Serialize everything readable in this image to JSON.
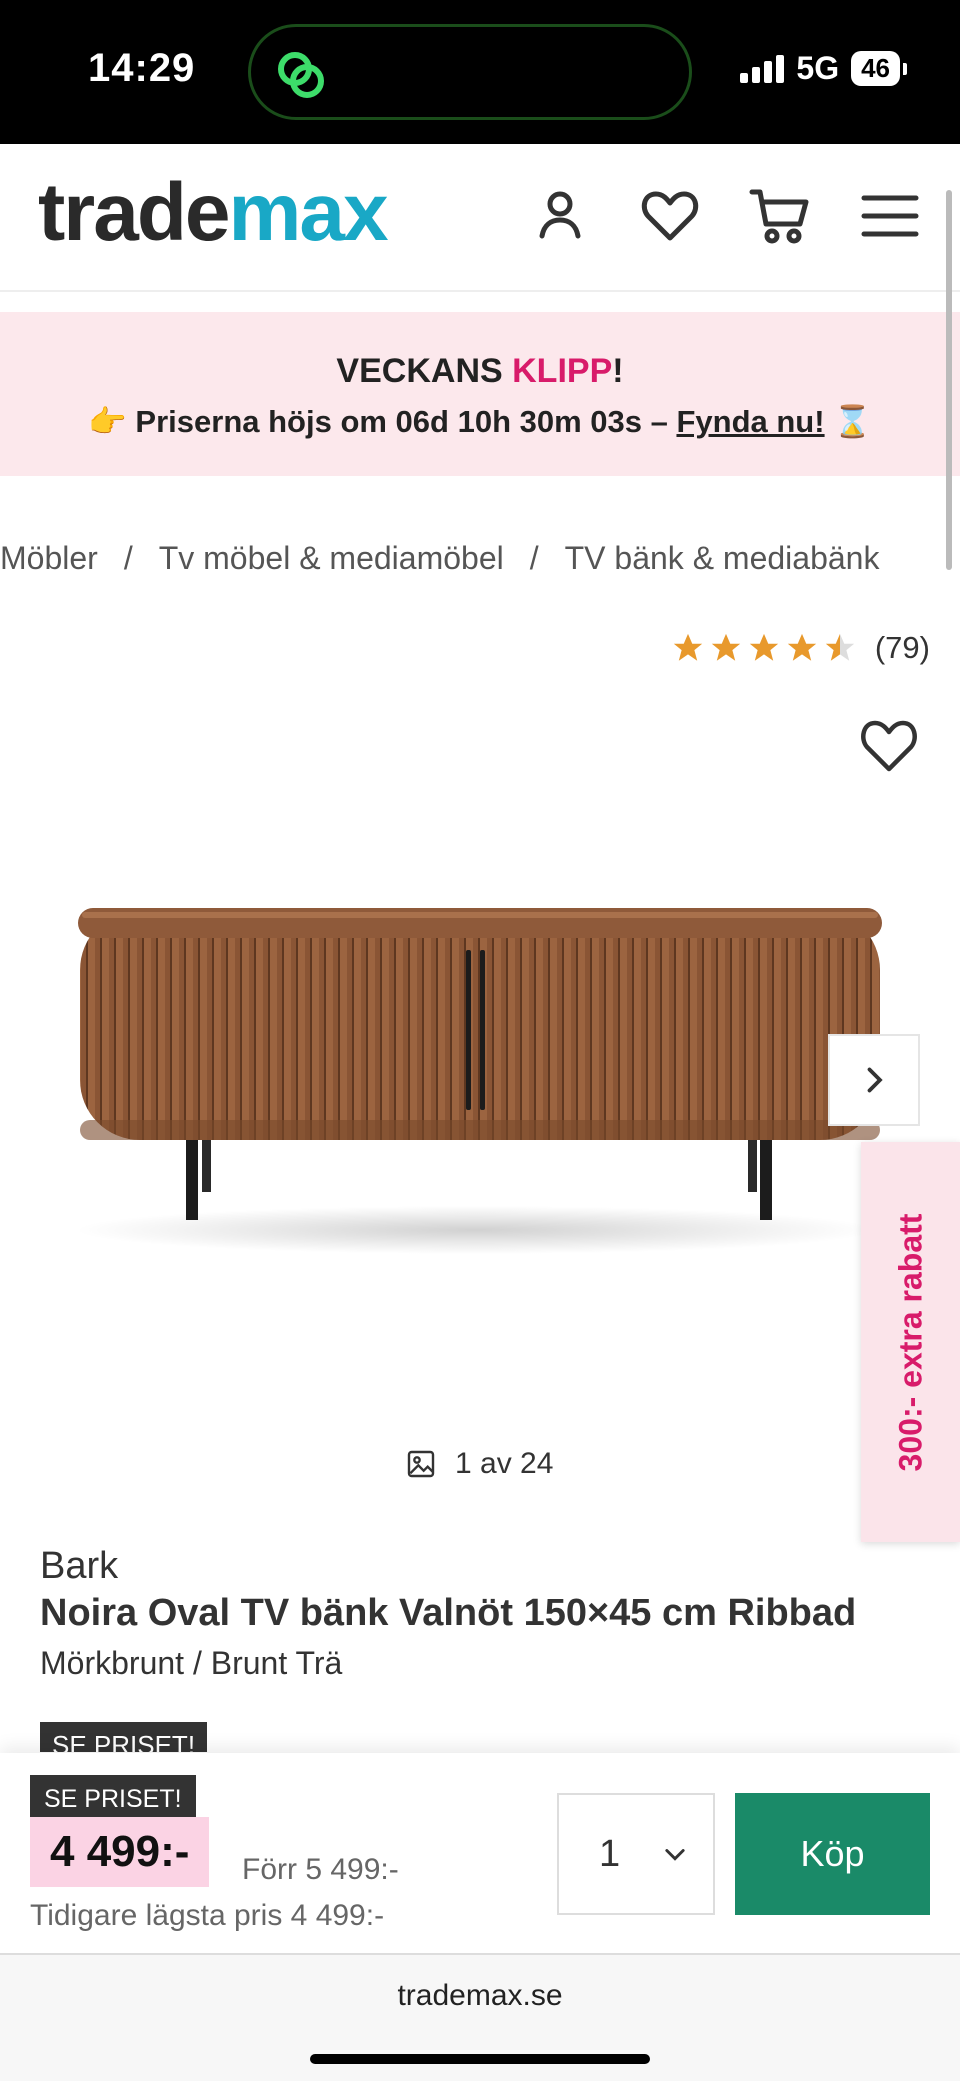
{
  "status_bar": {
    "time": "14:29",
    "network": "5G",
    "battery": "46"
  },
  "header": {
    "logo_part1": "trade",
    "logo_part2": "max"
  },
  "promo": {
    "title_part1": "VECKANS ",
    "title_accent": "KLIPP",
    "title_part2": "!",
    "emoji_left": "👉",
    "line_text": "Priserna höjs om 06d 10h 30m 03s – ",
    "line_link": "Fynda nu!",
    "emoji_right": "⌛"
  },
  "breadcrumb": [
    "Möbler",
    "Tv möbel & mediamöbel",
    "TV bänk & mediabänk"
  ],
  "breadcrumb_separator": "/",
  "rating": {
    "value": 4.5,
    "count": "(79)"
  },
  "side_tab": "300:- extra rabatt",
  "gallery": {
    "counter": "1 av 24"
  },
  "product": {
    "brand": "Bark",
    "title": "Noira Oval TV bänk Valnöt 150×45 cm Ribbad",
    "variant": "Mörkbrunt / Brunt Trä",
    "badge_peek": "SE PRISET!"
  },
  "buy_bar": {
    "badge": "SE PRISET!",
    "price": "4 499:-",
    "old_price": "Förr 5 499:-",
    "lowest_price": "Tidigare lägsta pris 4 499:-",
    "quantity": "1",
    "buy_label": "Köp"
  },
  "browser": {
    "url": "trademax.se"
  },
  "colors": {
    "brand_teal": "#19a8c6",
    "accent_pink": "#d81b6a",
    "buy_green": "#1a8a68",
    "promo_bg": "#fce8ec"
  }
}
